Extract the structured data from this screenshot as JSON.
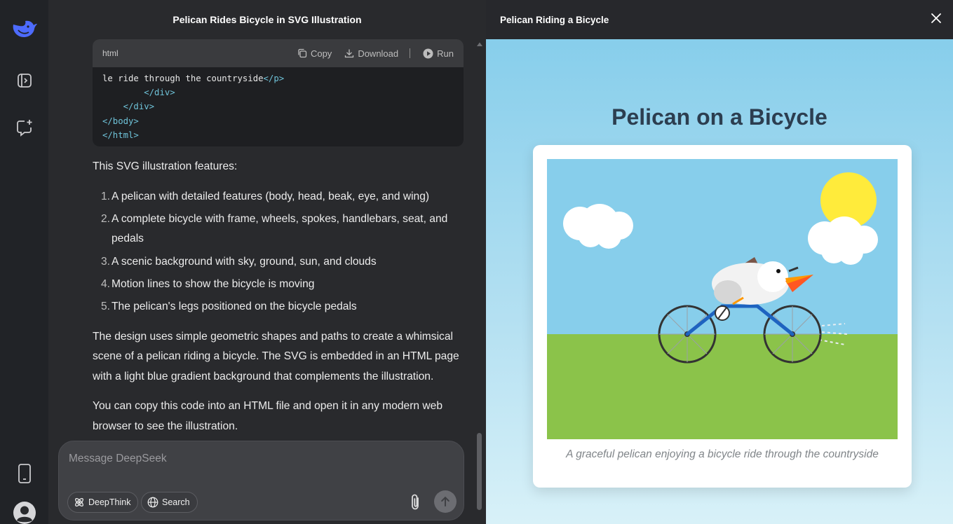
{
  "chat": {
    "title": "Pelican Rides Bicycle in SVG Illustration",
    "code": {
      "language": "html",
      "copy_label": "Copy",
      "download_label": "Download",
      "run_label": "Run",
      "lines": [
        {
          "indent": "",
          "text": "le ride through the countryside",
          "close_tag": "</p>"
        },
        {
          "indent": "        ",
          "tag": "</div>"
        },
        {
          "indent": "    ",
          "tag": "</div>"
        },
        {
          "indent": "",
          "tag": "</body>"
        },
        {
          "indent": "",
          "tag": "</html>"
        }
      ]
    },
    "intro": "This SVG illustration features:",
    "features": [
      "A pelican with detailed features (body, head, beak, eye, and wing)",
      "A complete bicycle with frame, wheels, spokes, handlebars, seat, and pedals",
      "A scenic background with sky, ground, sun, and clouds",
      "Motion lines to show the bicycle is moving",
      "The pelican's legs positioned on the bicycle pedals"
    ],
    "paragraph_design": "The design uses simple geometric shapes and paths to create a whimsical scene of a pelican riding a bicycle. The SVG is embedded in an HTML page with a light blue gradient background that complements the illustration.",
    "paragraph_copy": "You can copy this code into an HTML file and open it in any modern web browser to see the illustration."
  },
  "composer": {
    "placeholder": "Message DeepSeek",
    "deepthink_label": "DeepThink",
    "search_label": "Search"
  },
  "rail": {
    "icons": [
      "deepseek-logo-icon",
      "sidebar-toggle-icon",
      "new-chat-icon",
      "mobile-app-icon",
      "user-avatar-icon"
    ]
  },
  "panel": {
    "title": "Pelican Riding a Bicycle",
    "preview_heading": "Pelican on a Bicycle",
    "caption": "A graceful pelican enjoying a bicycle ride through the countryside"
  },
  "colors": {
    "accent": "#4d6bfe",
    "sky": "#87ceeb",
    "grass": "#8bc34a",
    "sun": "#ffeb3b",
    "frame": "#1e63c0",
    "beak": "#ff8c00",
    "heading": "#2c3e50"
  }
}
